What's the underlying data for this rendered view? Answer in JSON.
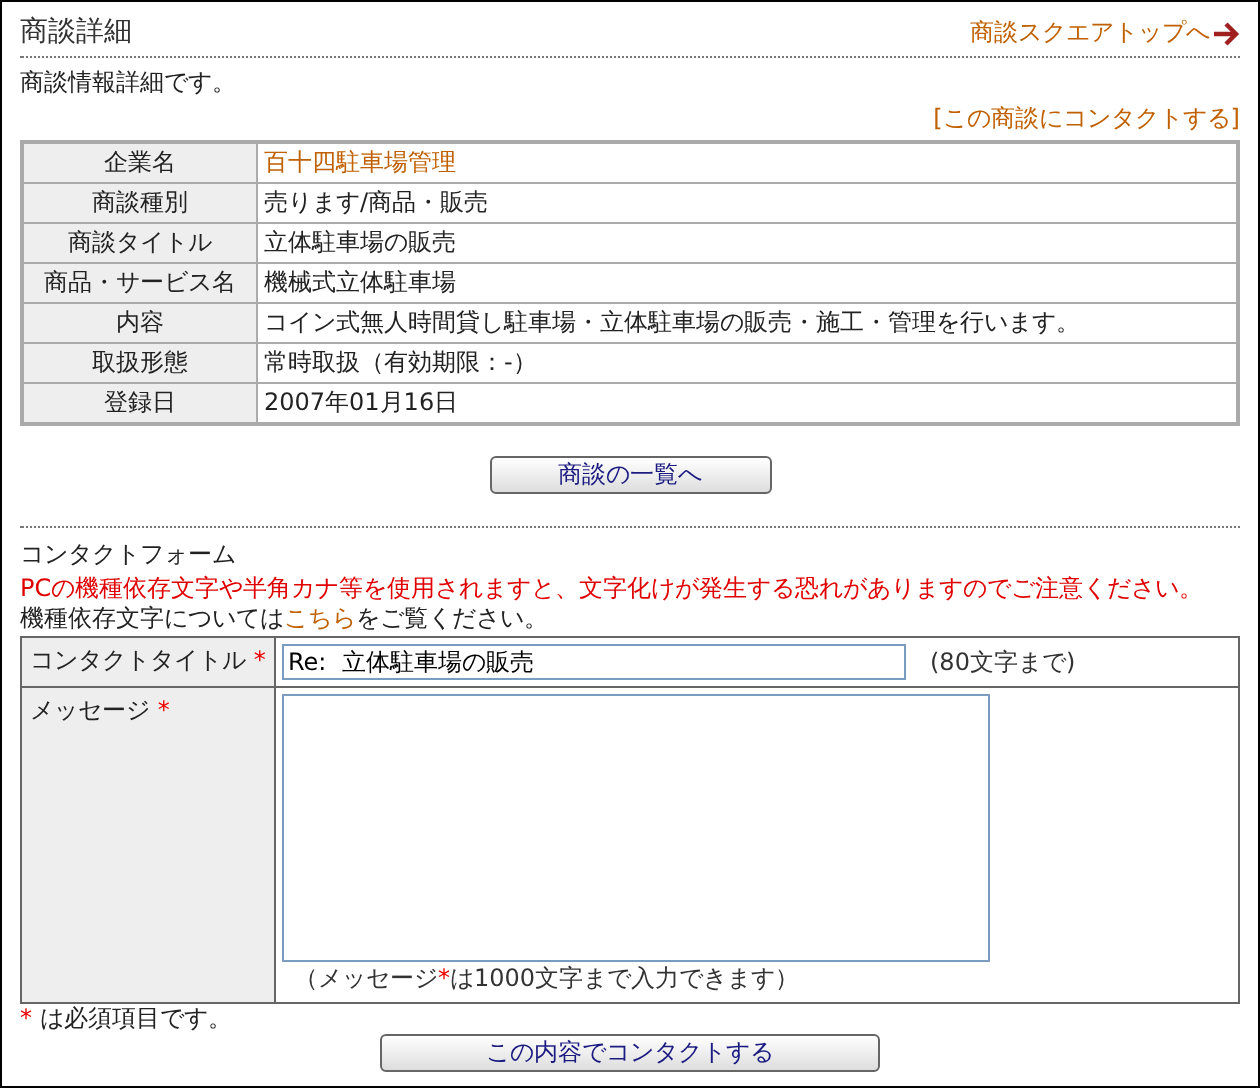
{
  "header": {
    "title": "商談詳細",
    "top_link": "商談スクエアトップへ"
  },
  "intro": "商談情報詳細です。",
  "contact_link": "[この商談にコンタクトする]",
  "details": [
    {
      "label": "企業名",
      "value": "百十四駐車場管理",
      "kind": "link"
    },
    {
      "label": "商談種別",
      "value": "売ります/商品・販売",
      "kind": "text"
    },
    {
      "label": "商談タイトル",
      "value": "立体駐車場の販売",
      "kind": "text"
    },
    {
      "label": "商品・サービス名",
      "value": "機械式立体駐車場",
      "kind": "text"
    },
    {
      "label": "内容",
      "value": "コイン式無人時間貸し駐車場・立体駐車場の販売・施工・管理を行います。",
      "kind": "text"
    },
    {
      "label": "取扱形態",
      "value": "常時取扱（有効期限：-）",
      "kind": "text"
    },
    {
      "label": "登録日",
      "value": "2007年01月16日",
      "kind": "text"
    }
  ],
  "list_button": "商談の一覧へ",
  "form": {
    "heading": "コンタクトフォーム",
    "warning": "PCの機種依存文字や半角カナ等を使用されますと、文字化けが発生する恐れがありますのでご注意ください。",
    "note": {
      "before": "機種依存文字については",
      "link": "こちら",
      "after": "をご覧ください。"
    },
    "fields": [
      {
        "kind": "input",
        "label": "コンタクトタイトル",
        "required_mark": "*",
        "value": "Re:  立体駐車場の販売",
        "hint": {
          "before": "(80文字まで)"
        }
      },
      {
        "kind": "textarea",
        "label": "メッセージ",
        "required_mark": "*",
        "hint": {
          "before": "（メッセージ",
          "mark": "*",
          "after": "は1000文字まで入力できます）"
        }
      }
    ],
    "footnote": {
      "mark": "*",
      "text": " は必須項目です。"
    },
    "submit": "この内容でコンタクトする"
  }
}
